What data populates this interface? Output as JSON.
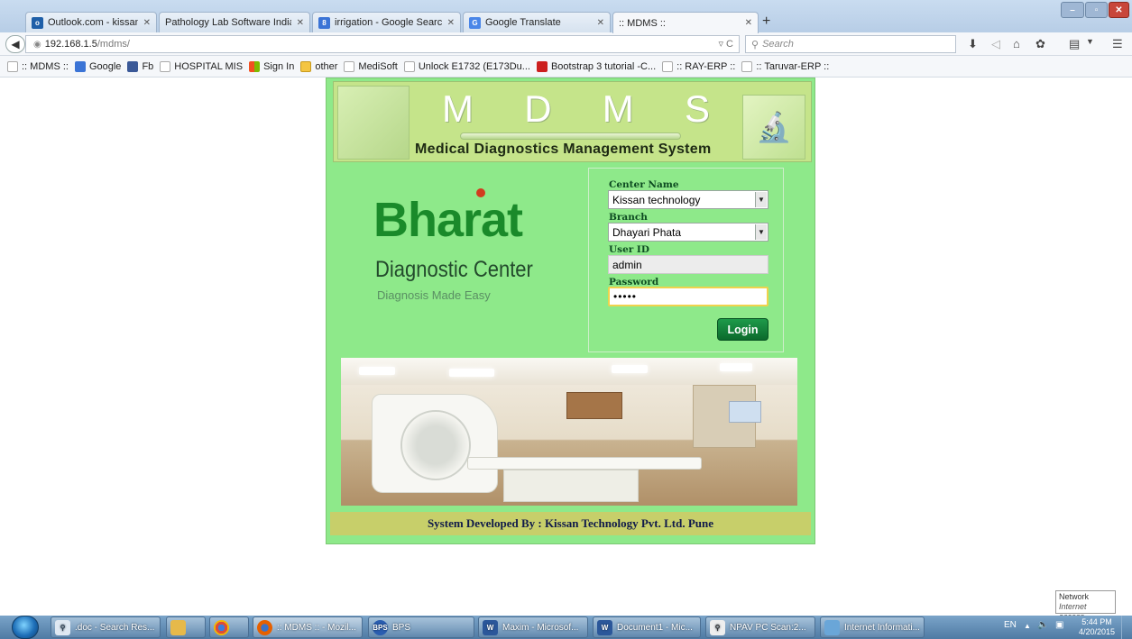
{
  "browser": {
    "tabs": [
      {
        "label": "Outlook.com - kissantech...",
        "icon": "outlook-icon",
        "color": "#1f5fa8"
      },
      {
        "label": "Pathology Lab Software India, ...",
        "icon": "page-icon",
        "color": "#ffffff"
      },
      {
        "label": "irrigation - Google Search",
        "icon": "google-icon",
        "color": "#3b74d6"
      },
      {
        "label": "Google Translate",
        "icon": "translate-icon",
        "color": "#4a86e8"
      },
      {
        "label": ":: MDMS ::",
        "icon": "page-icon",
        "color": "#ffffff"
      }
    ],
    "url_host": "192.168.1.5",
    "url_path": "/mdms/",
    "search_placeholder": "Search",
    "bookmarks": [
      ":: MDMS ::",
      "Google",
      "Fb",
      "HOSPITAL MIS",
      "Sign In",
      "other",
      "MediSoft",
      "Unlock E1732 (E173Du...",
      "Bootstrap 3 tutorial -C...",
      ":: RAY-ERP ::",
      ":: Taruvar-ERP ::"
    ]
  },
  "page": {
    "banner_letters": [
      "M",
      "D",
      "M",
      "S"
    ],
    "banner_subtitle": "Medical Diagnostics Management System",
    "brand_name": "Bharat",
    "brand_sub": "Diagnostic Center",
    "brand_tagline": "Diagnosis Made Easy",
    "form": {
      "center_label": "Center Name",
      "center_value": "Kissan technology",
      "branch_label": "Branch",
      "branch_value": "Dhayari Phata",
      "userid_label": "User ID",
      "userid_value": "admin",
      "password_label": "Password",
      "password_value": "•••••",
      "login_label": "Login"
    },
    "footer": "System Developed By : Kissan Technology Pvt. Ltd. Pune"
  },
  "taskbar": {
    "items": [
      {
        "label": ".doc - Search Res...",
        "icon": "search-icon"
      },
      {
        "label": "",
        "icon": "tools-icon"
      },
      {
        "label": "",
        "icon": "chrome-icon"
      },
      {
        "label": ":: MDMS :: - Mozil...",
        "icon": "firefox-icon"
      },
      {
        "label": "BPS",
        "icon": "bps-icon"
      },
      {
        "label": "Maxim - Microsof...",
        "icon": "word-icon"
      },
      {
        "label": "Document1 - Mic...",
        "icon": "word-icon"
      },
      {
        "label": "NPAV PC Scan:2...",
        "icon": "npav-icon"
      },
      {
        "label": "Internet Informati...",
        "icon": "iis-icon"
      }
    ],
    "lang": "EN",
    "time": "5:44 PM",
    "date": "4/20/2015",
    "tooltip_title": "Network",
    "tooltip_body": "Internet access"
  }
}
